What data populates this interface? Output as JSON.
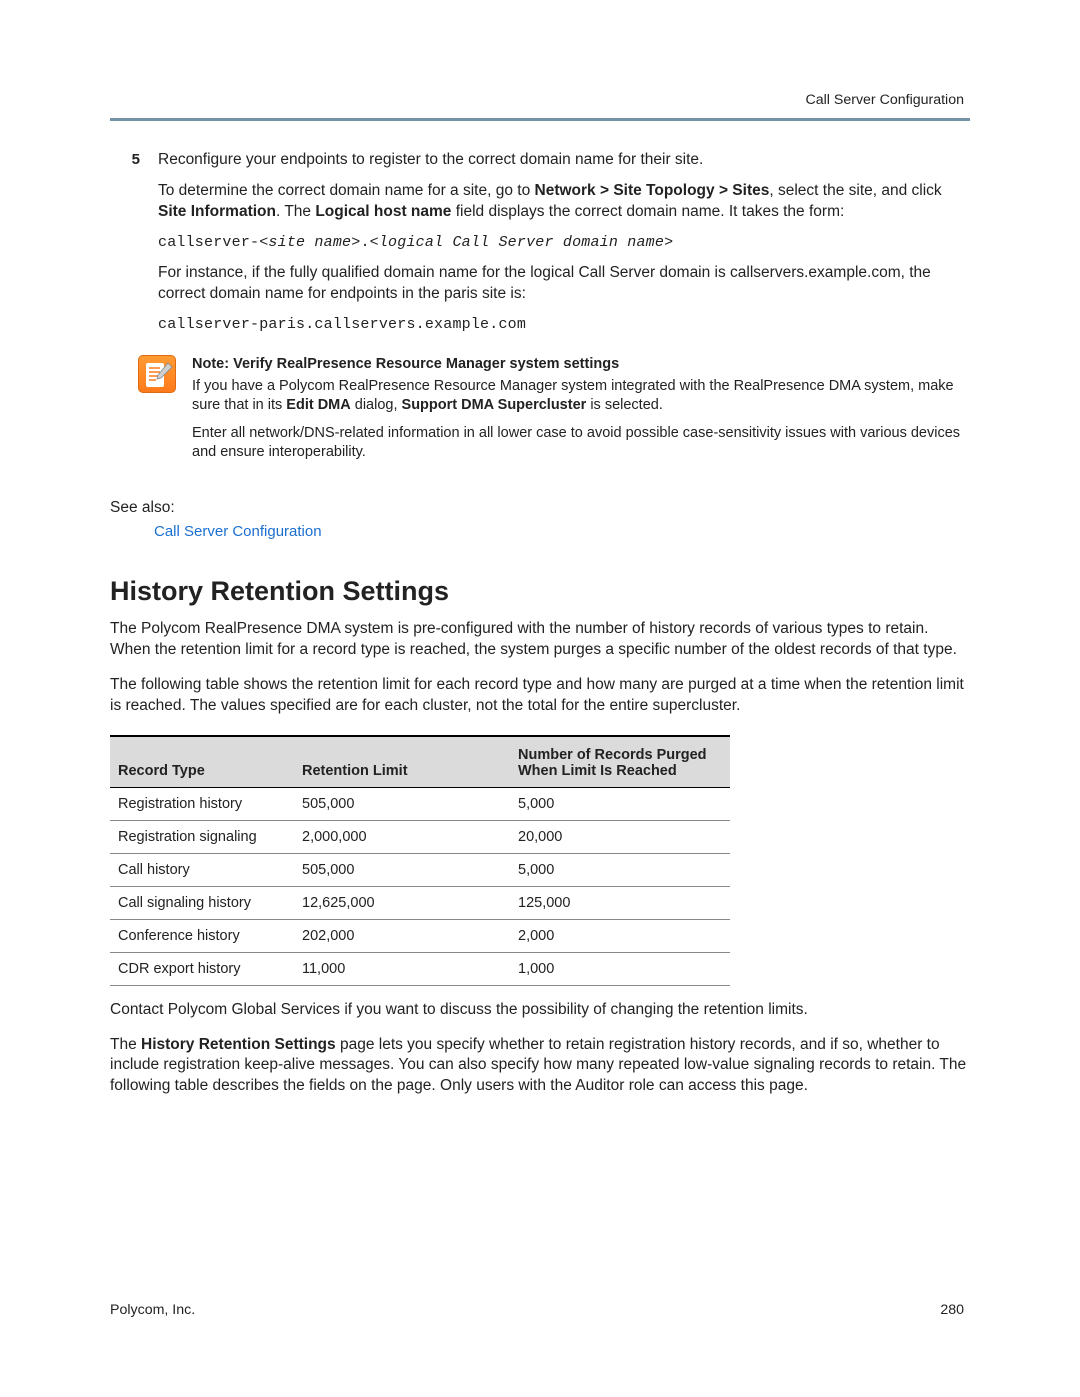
{
  "header": {
    "title": "Call Server Configuration"
  },
  "step5": {
    "number": "5",
    "line": "Reconfigure your endpoints to register to the correct domain name for their site.",
    "p1_a": "To determine the correct domain name for a site, go to ",
    "p1_b_bold": "Network > Site Topology > Sites",
    "p1_c": ", select the site, and click ",
    "p1_d_bold": "Site Information",
    "p1_e": ". The ",
    "p1_f_bold": "Logical host name",
    "p1_g": " field displays the correct domain name. It takes the form:",
    "code1_a": "callserver-",
    "code1_b_italic": "<site name>",
    "code1_c": ".",
    "code1_d_italic": "<logical Call Server domain name>",
    "p2": "For instance, if the fully qualified domain name for the logical Call Server domain is callservers.example.com, the correct domain name for endpoints in the paris site is:",
    "code2": "callserver-paris.callservers.example.com"
  },
  "note": {
    "heading": "Note: Verify RealPresence Resource Manager system settings",
    "p1_a": "If you have a Polycom RealPresence Resource Manager system integrated with the RealPresence DMA system, make sure that in its ",
    "p1_b_bold": "Edit DMA",
    "p1_c": " dialog, ",
    "p1_d_bold": "Support DMA Supercluster",
    "p1_e": " is selected.",
    "p2": "Enter all network/DNS-related information in all lower case to avoid possible case-sensitivity issues with various devices and ensure interoperability."
  },
  "see_also": {
    "label": "See also:",
    "link": "Call Server Configuration"
  },
  "section": {
    "title": "History Retention Settings",
    "p1": "The Polycom RealPresence DMA system is pre-configured with the number of history records of various types to retain. When the retention limit for a record type is reached, the system purges a specific number of the oldest records of that type.",
    "p2": "The following table shows the retention limit for each record type and how many are purged at a time when the retention limit is reached. The values specified are for each cluster, not the total for the entire supercluster."
  },
  "table": {
    "headers": [
      "Record Type",
      "Retention Limit",
      "Number of Records Purged When Limit Is Reached"
    ],
    "rows": [
      [
        "Registration history",
        "505,000",
        "5,000"
      ],
      [
        "Registration signaling",
        "2,000,000",
        "20,000"
      ],
      [
        "Call history",
        "505,000",
        "5,000"
      ],
      [
        "Call signaling history",
        "12,625,000",
        "125,000"
      ],
      [
        "Conference history",
        "202,000",
        "2,000"
      ],
      [
        "CDR export history",
        "11,000",
        "1,000"
      ]
    ]
  },
  "after_table": {
    "p1": "Contact Polycom Global Services if you want to discuss the possibility of changing the retention limits.",
    "p2_a": "The ",
    "p2_b_bold": "History Retention Settings",
    "p2_c": " page lets you specify whether to retain registration history records, and if so, whether to include registration keep-alive messages. You can also specify how many repeated low-value signaling records to retain. The following table describes the fields on the page. Only users with the Auditor role can access this page."
  },
  "footer": {
    "left": "Polycom, Inc.",
    "right": "280"
  }
}
